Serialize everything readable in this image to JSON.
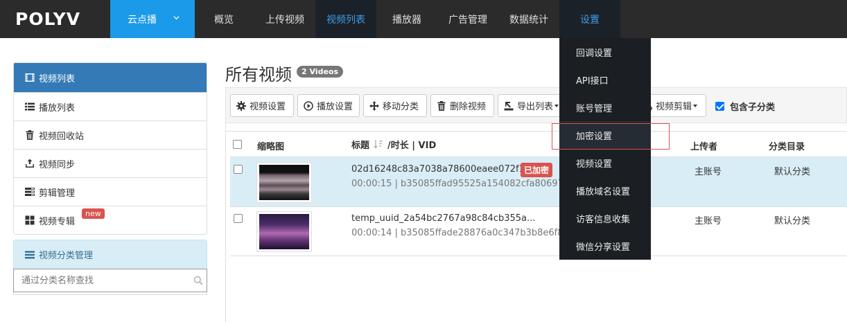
{
  "brand": {
    "logo_text": "POLYV"
  },
  "product_switch": {
    "label": "云点播"
  },
  "nav": {
    "items": [
      "概览",
      "上传视频",
      "视频列表",
      "播放器",
      "广告管理",
      "数据统计",
      "设置"
    ],
    "active": "视频列表",
    "open_menu": "设置"
  },
  "settings_menu": {
    "items": [
      "回调设置",
      "API接口",
      "账号管理",
      "加密设置",
      "视频设置",
      "播放域名设置",
      "访客信息收集",
      "微信分享设置"
    ],
    "highlighted": "加密设置"
  },
  "sidebar": {
    "header": "视频列表",
    "items": [
      {
        "label": "播放列表",
        "icon": "list-icon"
      },
      {
        "label": "视频回收站",
        "icon": "trash-icon"
      },
      {
        "label": "视频同步",
        "icon": "sync-icon"
      },
      {
        "label": "剪辑管理",
        "icon": "tasks-icon"
      },
      {
        "label": "视频专辑",
        "icon": "th-large-icon",
        "badge": "new"
      }
    ],
    "category": {
      "header": "视频分类管理",
      "search_placeholder": "通过分类名称查找"
    }
  },
  "main": {
    "title": "所有视频",
    "count_badge": "2 Videos",
    "toolbar": {
      "video_settings": "视频设置",
      "play_settings": "播放设置",
      "move_category": "移动分类",
      "delete_video": "删除视频",
      "export_list": "导出列表",
      "video_clip": "视频剪辑",
      "include_sub": "包含子分类",
      "include_sub_checked": true
    },
    "table": {
      "headers": {
        "thumbnail": "缩略图",
        "title": "标题",
        "duration_vid": "/时长 | VID",
        "uploader": "上传者",
        "category": "分类目录"
      },
      "rows": [
        {
          "title": "02d16248c83a7038a78600eaee072f10",
          "encrypted_badge": "已加密",
          "meta": "00:00:15 | b35085ffad95525a154082cfa8069726",
          "uploader": "主账号",
          "category": "默认分类",
          "selected": true
        },
        {
          "title": "temp_uuid_2a54bc2767a98c84cb355a...",
          "meta": "00:00:14 | b35085ffade28876a0c347b3b8e6f825",
          "uploader": "主账号",
          "category": "默认分类",
          "selected": false
        }
      ]
    }
  },
  "colors": {
    "topbar": "#2b2b2b",
    "product_switch": "#1a9ae8",
    "nav_active_text": "#3d9de8",
    "dropdown_bg": "#1b1f23",
    "sidebar_header": "#337ab7",
    "selected_row": "#d9edf7",
    "danger": "#d9534f",
    "highlight_outline": "#d9534f"
  }
}
